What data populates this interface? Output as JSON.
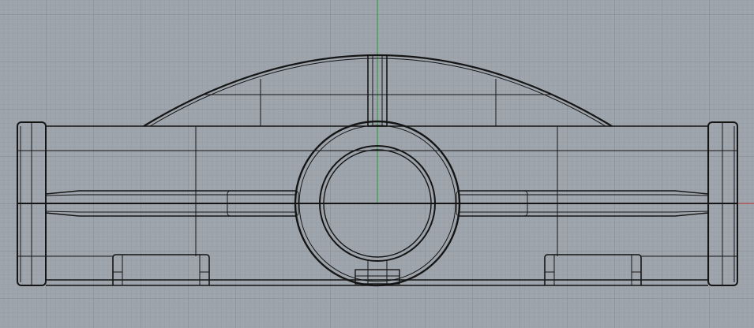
{
  "viewport": {
    "view": "Front",
    "display_mode": "Wireframe",
    "colors": {
      "background": "#9fa5ad",
      "grid_minor": "#959ba3",
      "grid_major": "#868c94",
      "x_axis": "#b04848",
      "y_axis": "#3f9a4a",
      "geometry": "#151515"
    }
  }
}
